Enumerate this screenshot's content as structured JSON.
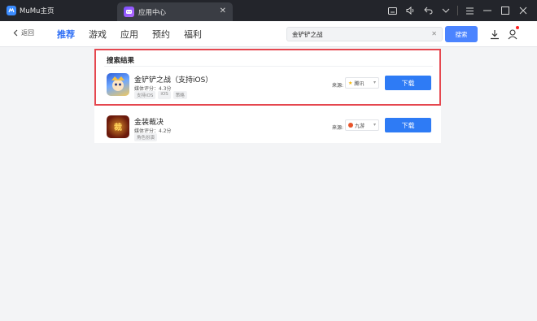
{
  "titlebar": {
    "app_name": "MuMu主页",
    "active_tab": "应用中心"
  },
  "nav": {
    "back_label": "返回",
    "tabs": [
      "推荐",
      "游戏",
      "应用",
      "预约",
      "福利"
    ],
    "active_tab_index": 0,
    "search_value": "金铲铲之战",
    "search_button": "搜索"
  },
  "results": {
    "section_title": "搜索结果",
    "items": [
      {
        "name": "金铲铲之战（支持iOS）",
        "rating": "媒体评分：4.3分",
        "tags": [
          "支持iOS",
          "iOS",
          "策略"
        ],
        "source_label": "来源:",
        "source_value": "腾讯",
        "download_label": "下载"
      },
      {
        "name": "金装裁决",
        "rating": "媒体评分：4.2分",
        "tags": [
          "角色扮演"
        ],
        "source_label": "来源:",
        "source_value": "九游",
        "download_label": "下载"
      }
    ]
  },
  "colors": {
    "accent": "#2e7bf5",
    "highlight": "#e5474f",
    "titlebar": "#23252b"
  }
}
